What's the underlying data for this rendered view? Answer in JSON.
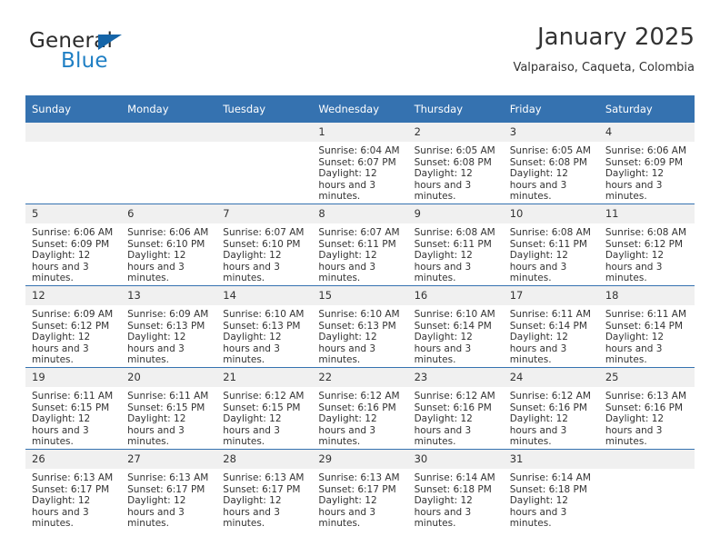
{
  "brand": {
    "name_top": "General",
    "name_bottom": "Blue",
    "triangle_icon": "triangle-icon",
    "color_dark": "#2b2b2b",
    "color_blue": "#1f7fc4",
    "triangle_color": "#1565a8"
  },
  "header": {
    "title": "January 2025",
    "subtitle": "Valparaiso, Caqueta, Colombia"
  },
  "theme": {
    "header_bg": "#3572b0",
    "header_text": "#ffffff",
    "daynum_bg": "#f0f0f0",
    "body_text": "#333333"
  },
  "weekdays": [
    "Sunday",
    "Monday",
    "Tuesday",
    "Wednesday",
    "Thursday",
    "Friday",
    "Saturday"
  ],
  "weeks": [
    [
      {
        "day": "",
        "empty": true,
        "sunrise": "",
        "sunset": "",
        "daylight": ""
      },
      {
        "day": "",
        "empty": true,
        "sunrise": "",
        "sunset": "",
        "daylight": ""
      },
      {
        "day": "",
        "empty": true,
        "sunrise": "",
        "sunset": "",
        "daylight": ""
      },
      {
        "day": "1",
        "empty": false,
        "sunrise": "Sunrise: 6:04 AM",
        "sunset": "Sunset: 6:07 PM",
        "daylight": "Daylight: 12 hours and 3 minutes."
      },
      {
        "day": "2",
        "empty": false,
        "sunrise": "Sunrise: 6:05 AM",
        "sunset": "Sunset: 6:08 PM",
        "daylight": "Daylight: 12 hours and 3 minutes."
      },
      {
        "day": "3",
        "empty": false,
        "sunrise": "Sunrise: 6:05 AM",
        "sunset": "Sunset: 6:08 PM",
        "daylight": "Daylight: 12 hours and 3 minutes."
      },
      {
        "day": "4",
        "empty": false,
        "sunrise": "Sunrise: 6:06 AM",
        "sunset": "Sunset: 6:09 PM",
        "daylight": "Daylight: 12 hours and 3 minutes."
      }
    ],
    [
      {
        "day": "5",
        "empty": false,
        "sunrise": "Sunrise: 6:06 AM",
        "sunset": "Sunset: 6:09 PM",
        "daylight": "Daylight: 12 hours and 3 minutes."
      },
      {
        "day": "6",
        "empty": false,
        "sunrise": "Sunrise: 6:06 AM",
        "sunset": "Sunset: 6:10 PM",
        "daylight": "Daylight: 12 hours and 3 minutes."
      },
      {
        "day": "7",
        "empty": false,
        "sunrise": "Sunrise: 6:07 AM",
        "sunset": "Sunset: 6:10 PM",
        "daylight": "Daylight: 12 hours and 3 minutes."
      },
      {
        "day": "8",
        "empty": false,
        "sunrise": "Sunrise: 6:07 AM",
        "sunset": "Sunset: 6:11 PM",
        "daylight": "Daylight: 12 hours and 3 minutes."
      },
      {
        "day": "9",
        "empty": false,
        "sunrise": "Sunrise: 6:08 AM",
        "sunset": "Sunset: 6:11 PM",
        "daylight": "Daylight: 12 hours and 3 minutes."
      },
      {
        "day": "10",
        "empty": false,
        "sunrise": "Sunrise: 6:08 AM",
        "sunset": "Sunset: 6:11 PM",
        "daylight": "Daylight: 12 hours and 3 minutes."
      },
      {
        "day": "11",
        "empty": false,
        "sunrise": "Sunrise: 6:08 AM",
        "sunset": "Sunset: 6:12 PM",
        "daylight": "Daylight: 12 hours and 3 minutes."
      }
    ],
    [
      {
        "day": "12",
        "empty": false,
        "sunrise": "Sunrise: 6:09 AM",
        "sunset": "Sunset: 6:12 PM",
        "daylight": "Daylight: 12 hours and 3 minutes."
      },
      {
        "day": "13",
        "empty": false,
        "sunrise": "Sunrise: 6:09 AM",
        "sunset": "Sunset: 6:13 PM",
        "daylight": "Daylight: 12 hours and 3 minutes."
      },
      {
        "day": "14",
        "empty": false,
        "sunrise": "Sunrise: 6:10 AM",
        "sunset": "Sunset: 6:13 PM",
        "daylight": "Daylight: 12 hours and 3 minutes."
      },
      {
        "day": "15",
        "empty": false,
        "sunrise": "Sunrise: 6:10 AM",
        "sunset": "Sunset: 6:13 PM",
        "daylight": "Daylight: 12 hours and 3 minutes."
      },
      {
        "day": "16",
        "empty": false,
        "sunrise": "Sunrise: 6:10 AM",
        "sunset": "Sunset: 6:14 PM",
        "daylight": "Daylight: 12 hours and 3 minutes."
      },
      {
        "day": "17",
        "empty": false,
        "sunrise": "Sunrise: 6:11 AM",
        "sunset": "Sunset: 6:14 PM",
        "daylight": "Daylight: 12 hours and 3 minutes."
      },
      {
        "day": "18",
        "empty": false,
        "sunrise": "Sunrise: 6:11 AM",
        "sunset": "Sunset: 6:14 PM",
        "daylight": "Daylight: 12 hours and 3 minutes."
      }
    ],
    [
      {
        "day": "19",
        "empty": false,
        "sunrise": "Sunrise: 6:11 AM",
        "sunset": "Sunset: 6:15 PM",
        "daylight": "Daylight: 12 hours and 3 minutes."
      },
      {
        "day": "20",
        "empty": false,
        "sunrise": "Sunrise: 6:11 AM",
        "sunset": "Sunset: 6:15 PM",
        "daylight": "Daylight: 12 hours and 3 minutes."
      },
      {
        "day": "21",
        "empty": false,
        "sunrise": "Sunrise: 6:12 AM",
        "sunset": "Sunset: 6:15 PM",
        "daylight": "Daylight: 12 hours and 3 minutes."
      },
      {
        "day": "22",
        "empty": false,
        "sunrise": "Sunrise: 6:12 AM",
        "sunset": "Sunset: 6:16 PM",
        "daylight": "Daylight: 12 hours and 3 minutes."
      },
      {
        "day": "23",
        "empty": false,
        "sunrise": "Sunrise: 6:12 AM",
        "sunset": "Sunset: 6:16 PM",
        "daylight": "Daylight: 12 hours and 3 minutes."
      },
      {
        "day": "24",
        "empty": false,
        "sunrise": "Sunrise: 6:12 AM",
        "sunset": "Sunset: 6:16 PM",
        "daylight": "Daylight: 12 hours and 3 minutes."
      },
      {
        "day": "25",
        "empty": false,
        "sunrise": "Sunrise: 6:13 AM",
        "sunset": "Sunset: 6:16 PM",
        "daylight": "Daylight: 12 hours and 3 minutes."
      }
    ],
    [
      {
        "day": "26",
        "empty": false,
        "sunrise": "Sunrise: 6:13 AM",
        "sunset": "Sunset: 6:17 PM",
        "daylight": "Daylight: 12 hours and 3 minutes."
      },
      {
        "day": "27",
        "empty": false,
        "sunrise": "Sunrise: 6:13 AM",
        "sunset": "Sunset: 6:17 PM",
        "daylight": "Daylight: 12 hours and 3 minutes."
      },
      {
        "day": "28",
        "empty": false,
        "sunrise": "Sunrise: 6:13 AM",
        "sunset": "Sunset: 6:17 PM",
        "daylight": "Daylight: 12 hours and 3 minutes."
      },
      {
        "day": "29",
        "empty": false,
        "sunrise": "Sunrise: 6:13 AM",
        "sunset": "Sunset: 6:17 PM",
        "daylight": "Daylight: 12 hours and 3 minutes."
      },
      {
        "day": "30",
        "empty": false,
        "sunrise": "Sunrise: 6:14 AM",
        "sunset": "Sunset: 6:18 PM",
        "daylight": "Daylight: 12 hours and 3 minutes."
      },
      {
        "day": "31",
        "empty": false,
        "sunrise": "Sunrise: 6:14 AM",
        "sunset": "Sunset: 6:18 PM",
        "daylight": "Daylight: 12 hours and 3 minutes."
      },
      {
        "day": "",
        "empty": true,
        "sunrise": "",
        "sunset": "",
        "daylight": ""
      }
    ]
  ]
}
